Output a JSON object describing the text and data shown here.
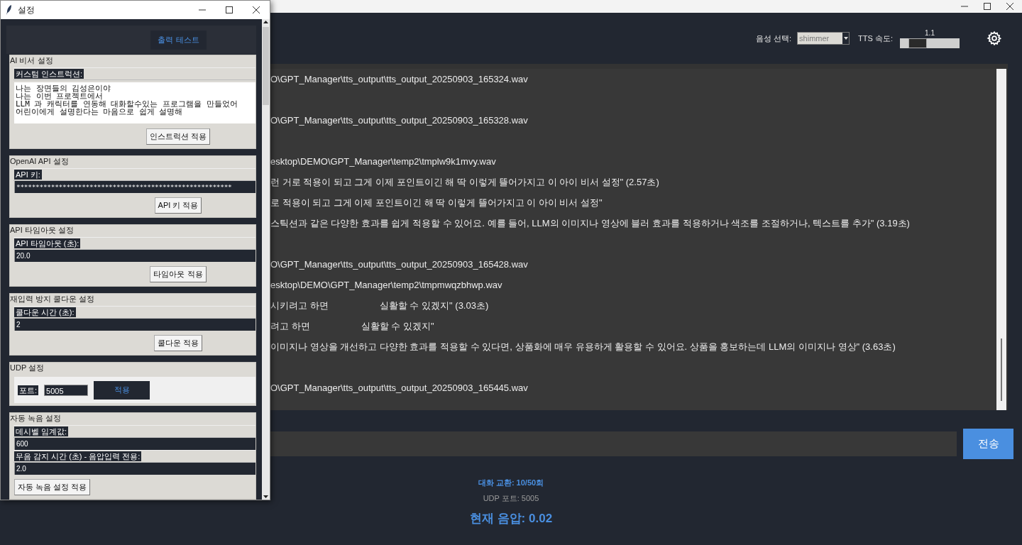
{
  "header": {
    "voice": {
      "label": "음성 선택:",
      "value": "shimmer",
      "disabled": true
    },
    "speed": {
      "label": "TTS 속도:",
      "reading": "1.1",
      "level": 0.2
    }
  },
  "log": {
    "lines": [
      {
        "kind": "text",
        "text": "O\\GPT_Manager\\tts_output\\tts_output_20250903_165324.wav"
      },
      {
        "kind": "blank"
      },
      {
        "kind": "text",
        "text": "O\\GPT_Manager\\tts_output\\tts_output_20250903_165328.wav"
      },
      {
        "kind": "blank"
      },
      {
        "kind": "text",
        "text": "esktop\\DEMO\\GPT_Manager\\temp2\\tmplw9k1mvy.wav"
      },
      {
        "kind": "text",
        "text": "런 거로 적용이 되고 그게 이제 포인트이긴 해 딱 이렇게 뜰어가지고 이 아이 비서 설정\" (2.57초)"
      },
      {
        "kind": "text",
        "text": "로 적용이 되고 그게 이제 포인트이긴 해 딱 이렇게 뜰어가지고 이 아이 비서 설정\""
      },
      {
        "kind": "text",
        "text": "스틱션과 같은 다양한 효과를 쉽게 적용할 수 있어요. 예를 들어, LLM의 이미지나 영상에 블러 효과를 적용하거나 색조를 조절하거나, 텍스트를 추가\" (3.19초)"
      },
      {
        "kind": "blank"
      },
      {
        "kind": "text",
        "text": "O\\GPT_Manager\\tts_output\\tts_output_20250903_165428.wav"
      },
      {
        "kind": "text",
        "text": "esktop\\DEMO\\GPT_Manager\\temp2\\tmpmwqzbhwp.wav"
      },
      {
        "kind": "text",
        "text": "시키려고 하면                    실활할 수 있겠지\" (3.03초)"
      },
      {
        "kind": "text",
        "text": "려고 하면                    실활할 수 있겠지\""
      },
      {
        "kind": "text",
        "text": "이미지나 영상을 개선하고 다양한 효과를 적용할 수 있다면, 상품화에 매우 유용하게 활용할 수 있어요. 상품을 홍보하는데 LLM의 이미지나 영상\" (3.63초)"
      },
      {
        "kind": "blank"
      },
      {
        "kind": "text",
        "text": "O\\GPT_Manager\\tts_output\\tts_output_20250903_165445.wav"
      }
    ]
  },
  "composer": {
    "send_button": "전송"
  },
  "status": {
    "exchanges": "대화 교환: 10/50회",
    "udp": "UDP 포트: 5005",
    "pressure": "현재 음압: 0.02"
  },
  "settings_dialog": {
    "title": "설정",
    "test_button": "출력 테스트",
    "sections": [
      {
        "title": "AI 비서 설정",
        "items": [
          {
            "kind": "label",
            "text": "커스텀 인스트럭션:"
          },
          {
            "kind": "textarea",
            "lines": [
              "나는 장면들의 김성은이야",
              "나는 이번 프로젝트에서",
              "LLM 과 캐릭터를 연동해 대화할수있는 프로그램을 만들었어",
              "어린이에게 설명한다는 마음으로 쉽게 설명해"
            ]
          },
          {
            "kind": "button",
            "label": "인스트럭션 적용"
          }
        ]
      },
      {
        "title": "OpenAI API 설정",
        "items": [
          {
            "kind": "label",
            "text": "API 키:"
          },
          {
            "kind": "entry",
            "value": "********************************************************"
          },
          {
            "kind": "button",
            "label": "API 키 적용"
          }
        ]
      },
      {
        "title": "API 타임아웃 설정",
        "items": [
          {
            "kind": "label",
            "text": "API 타임아웃 (초):"
          },
          {
            "kind": "entry",
            "value": "20.0"
          },
          {
            "kind": "button",
            "label": "타임아웃 적용"
          }
        ]
      },
      {
        "title": "재입력 방지 쿨다운 설정",
        "items": [
          {
            "kind": "label",
            "text": "쿨다운 시간 (초):"
          },
          {
            "kind": "entry",
            "value": "2"
          },
          {
            "kind": "button",
            "label": "쿨다운 적용"
          }
        ]
      },
      {
        "title": "UDP 설정",
        "items": [
          {
            "kind": "inline",
            "label": "포트:",
            "value": "5005",
            "button": "적용"
          }
        ]
      },
      {
        "title": "자동 녹음 설정",
        "items": [
          {
            "kind": "label",
            "text": "데시벨 임계값:"
          },
          {
            "kind": "entry",
            "value": "600"
          },
          {
            "kind": "label",
            "text": "무음 감지 시간 (초) - 음압입력 전용:"
          },
          {
            "kind": "entry",
            "value": "2.0"
          },
          {
            "kind": "left_button",
            "label": "자동 녹음 설정 적용"
          }
        ]
      }
    ]
  }
}
